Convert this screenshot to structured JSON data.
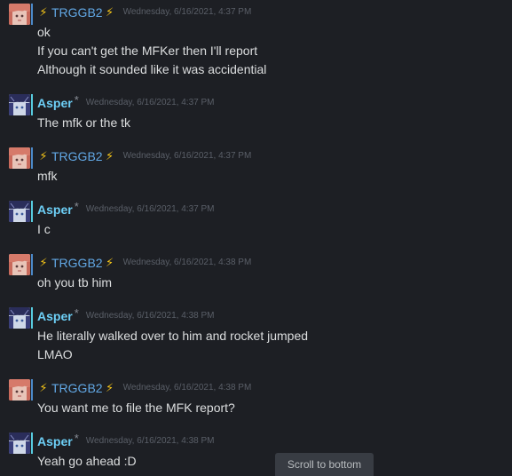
{
  "messages": [
    {
      "author": "TRGGB2",
      "timestamp": "Wednesday, 6/16/2021, 4:37 PM",
      "lines": [
        "ok",
        "If you can't get the MFKer then I'll report",
        "Although it sounded like it was accidential"
      ]
    },
    {
      "author": "Asper",
      "timestamp": "Wednesday, 6/16/2021, 4:37 PM",
      "lines": [
        "The mfk or the tk"
      ]
    },
    {
      "author": "TRGGB2",
      "timestamp": "Wednesday, 6/16/2021, 4:37 PM",
      "lines": [
        "mfk"
      ]
    },
    {
      "author": "Asper",
      "timestamp": "Wednesday, 6/16/2021, 4:37 PM",
      "lines": [
        "I c"
      ]
    },
    {
      "author": "TRGGB2",
      "timestamp": "Wednesday, 6/16/2021, 4:38 PM",
      "lines": [
        "oh you tb him"
      ]
    },
    {
      "author": "Asper",
      "timestamp": "Wednesday, 6/16/2021, 4:38 PM",
      "lines": [
        "He literally walked over to him and rocket jumped",
        "LMAO"
      ]
    },
    {
      "author": "TRGGB2",
      "timestamp": "Wednesday, 6/16/2021, 4:38 PM",
      "lines": [
        "You want me to file the MFK report?"
      ]
    },
    {
      "author": "Asper",
      "timestamp": "Wednesday, 6/16/2021, 4:38 PM",
      "lines": [
        "Yeah go ahead :D"
      ]
    }
  ],
  "icons": {
    "trggb2_decoration": "lightning-bolt-icon",
    "asper_decoration": "star-icon",
    "trggb2_avatar": "anime-girl-pink-avatar",
    "asper_avatar": "anime-character-dark-avatar"
  },
  "colors": {
    "background": "#1d1f24",
    "trggb2_name": "#62a8e5",
    "asper_name": "#6dcff6",
    "bolt": "#f5c518",
    "message_text": "#dcdedf",
    "timestamp": "#5a5f68"
  },
  "scroll_button": {
    "label": "Scroll to bottom"
  }
}
